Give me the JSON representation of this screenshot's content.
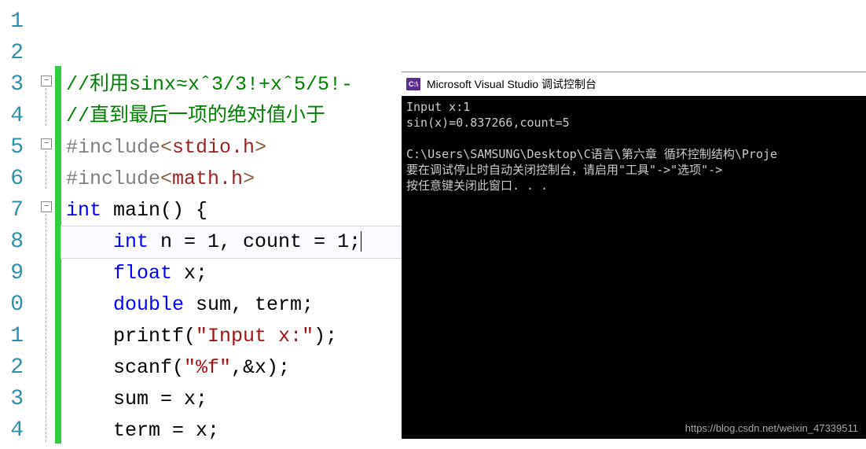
{
  "lineNumbers": [
    "1",
    "2",
    "3",
    "4",
    "5",
    "6",
    "7",
    "8",
    "9",
    "0",
    "1",
    "2",
    "3",
    "4"
  ],
  "code": {
    "l3_comment": "//利用sinx≈xˆ3/3!+xˆ5/5!-",
    "l4_comment": "//直到最后一项的绝对值小于",
    "l5_inc": "#include",
    "l5_hdr": "stdio.h",
    "l6_inc": "#include",
    "l6_hdr": "math.h",
    "l7_kw": "int",
    "l7_rest": " main() {",
    "l8_kw": "int",
    "l8_rest": " n = 1, count = 1;",
    "l9_kw": "float",
    "l9_rest": " x;",
    "l10_kw": "double",
    "l10_rest": " sum, term;",
    "l11_call": "printf(",
    "l11_str": "\"Input x:\"",
    "l11_end": ");",
    "l12_call": "scanf(",
    "l12_str": "\"%f\"",
    "l12_end": ",&x);",
    "l13": "sum = x;",
    "l14": "term = x;"
  },
  "console": {
    "icon": "C:\\",
    "title": "Microsoft Visual Studio 调试控制台",
    "line1": "Input x:1",
    "line2": "sin(x)=0.837266,count=5",
    "line3": "",
    "line4": "C:\\Users\\SAMSUNG\\Desktop\\C语言\\第六章 循环控制结构\\Proje",
    "line5": "要在调试停止时自动关闭控制台，请启用\"工具\"->\"选项\"->",
    "line6": "按任意键关闭此窗口. . ."
  },
  "watermark": "https://blog.csdn.net/weixin_47339511"
}
